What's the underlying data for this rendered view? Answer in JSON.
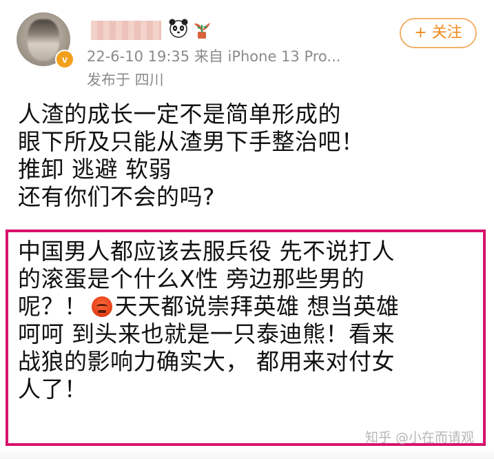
{
  "post": {
    "meta": "22-6-10 19:35  来自 iPhone 13 Pro...",
    "location": "发布于 四川",
    "follow_label": "+ 关注",
    "verified_badge": "v",
    "lines": [
      "人渣的成长一定不是简单形成的",
      "眼下所及只能从渣男下手整治吧！",
      "推卸 逃避 软弱",
      "还有你们不会的吗?"
    ],
    "highlight_lines": [
      "中国男人都应该去服兵役 先不说打人",
      "的滚蛋是个什么X性 旁边那些男的",
      "呢？！",
      "天天都说崇拜英雄 想当英雄",
      "呵呵 到头来也就是一只泰迪熊！看来",
      "战狼的影响力确实大， 都用来对付女",
      "人了！"
    ]
  },
  "watermark": "知乎 @小在而请观",
  "icons": {
    "avatar": "avatar",
    "verified": "verified-badge-icon",
    "panda": "panda-emoji-icon",
    "plant": "plant-emoji-icon",
    "angry": "angry-face-emoji-icon"
  },
  "colors": {
    "highlight_border": "#d7136b",
    "follow_accent": "#f08a1c",
    "meta_text": "#8a8a8a"
  }
}
